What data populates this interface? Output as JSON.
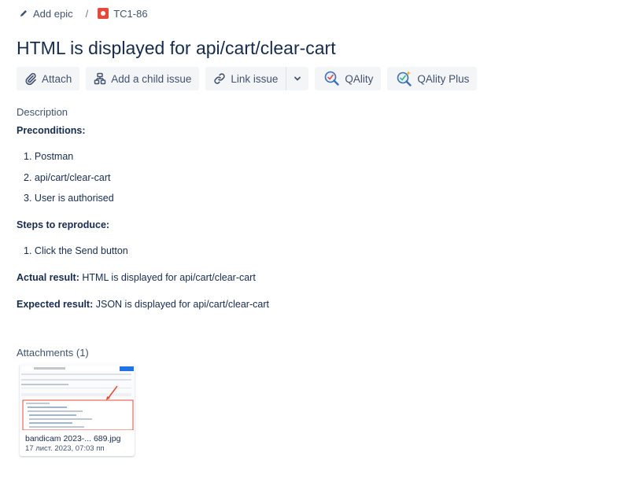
{
  "breadcrumb": {
    "epic_label": "Add epic",
    "separator": "/",
    "issue_key": "TC1-86"
  },
  "issue": {
    "title": "HTML is displayed for api/cart/clear-cart"
  },
  "toolbar": {
    "attach": "Attach",
    "child_issue": "Add a child issue",
    "link_issue": "Link issue",
    "qality": "QAlity",
    "qality_plus": "QAlity Plus"
  },
  "description": {
    "label": "Description",
    "preconditions_heading": "Preconditions:",
    "preconditions": [
      {
        "num": "1.",
        "text": "Postman"
      },
      {
        "num": "2.",
        "text": "api/cart/clear-cart"
      },
      {
        "num": "3.",
        "text": "User is authorised"
      }
    ],
    "steps_heading": "Steps to reproduce:",
    "steps": [
      {
        "num": "1.",
        "text": "Click the Send button"
      }
    ],
    "actual_label": "Actual result:",
    "actual_text": "HTML is displayed for api/cart/clear-cart",
    "expected_label": "Expected result:",
    "expected_text": "JSON is displayed for api/cart/clear-cart"
  },
  "attachments": {
    "label": "Attachments (1)",
    "items": [
      {
        "name": "bandicam 2023-... 689.jpg",
        "date": "17 лист. 2023, 07:03 пп"
      }
    ]
  },
  "colors": {
    "bug": "#e5493a",
    "text": "#172b4d",
    "subtle": "#42526e",
    "button_bg": "#f4f5f7"
  }
}
